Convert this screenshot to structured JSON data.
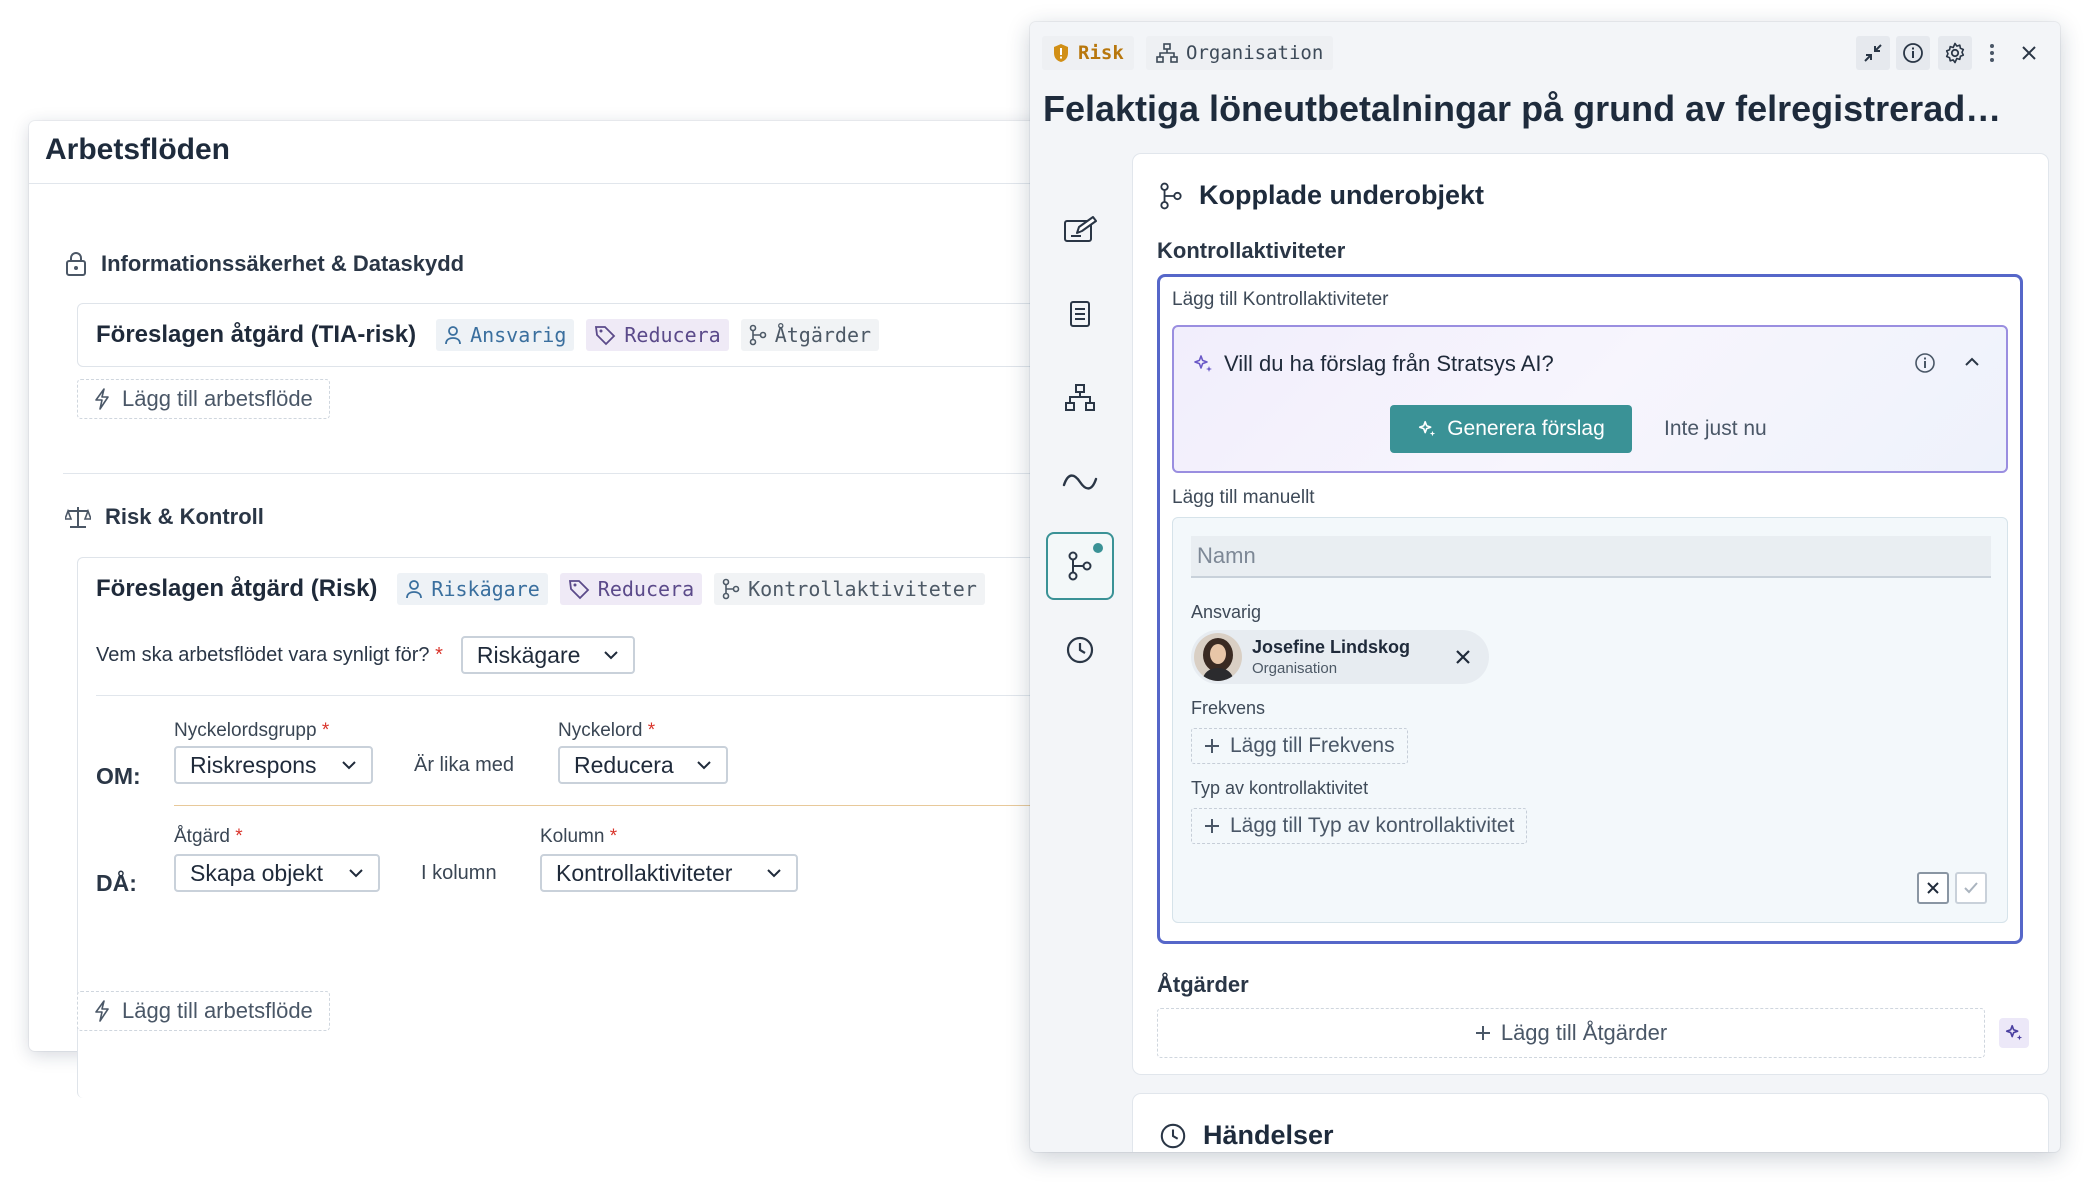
{
  "workflows_panel": {
    "title": "Arbetsflöden",
    "sections": [
      {
        "icon": "lock-icon",
        "label": "Informationssäkerhet & Dataskydd",
        "workflow": {
          "title": "Föreslagen åtgärd (TIA-risk)",
          "chips": [
            "Ansvarig",
            "Reducera",
            "Åtgärder"
          ]
        },
        "add_label": "Lägg till arbetsflöde"
      },
      {
        "icon": "scale-icon",
        "label": "Risk & Kontroll",
        "workflow": {
          "title": "Föreslagen åtgärd (Risk)",
          "chips": [
            "Riskägare",
            "Reducera",
            "Kontrollaktiviteter"
          ],
          "visibility_question": "Vem ska arbetsflödet vara synligt för?",
          "visibility_value": "Riskägare",
          "if": {
            "keyword": "OM:",
            "group_label": "Nyckelordsgrupp",
            "group_value": "Riskrespons",
            "operator": "Är lika med",
            "keyword_label": "Nyckelord",
            "keyword_value": "Reducera"
          },
          "then": {
            "keyword": "DÅ:",
            "action_label": "Åtgärd",
            "action_value": "Skapa objekt",
            "in_column": "I kolumn",
            "column_label": "Kolumn",
            "column_value": "Kontrollaktiviteter"
          }
        },
        "add_label": "Lägg till arbetsflöde"
      }
    ],
    "required_mark": "*"
  },
  "detail_panel": {
    "tags": {
      "risk": "Risk",
      "org": "Organisation"
    },
    "title": "Felaktiga löneutbetalningar på grund av felregistrerad…",
    "rail_icons": [
      "edit-icon",
      "document-icon",
      "hierarchy-icon",
      "wave-icon",
      "branch-icon",
      "clock-icon"
    ],
    "linked": {
      "heading": "Kopplade underobjekt",
      "controls_heading": "Kontrollaktiviteter",
      "add_controls_label": "Lägg till Kontrollaktiviteter",
      "ai_prompt": "Vill du ha förslag från Stratsys AI?",
      "generate_label": "Generera förslag",
      "not_now_label": "Inte just nu",
      "manual_label": "Lägg till manuellt",
      "name_placeholder": "Namn",
      "responsible_label": "Ansvarig",
      "person_name": "Josefine Lindskog",
      "person_org": "Organisation",
      "frequency_label": "Frekvens",
      "add_frequency": "Lägg till Frekvens",
      "type_label": "Typ av kontrollaktivitet",
      "add_type": "Lägg till Typ av kontrollaktivitet",
      "actions_heading": "Åtgärder",
      "add_actions": "Lägg till Åtgärder"
    },
    "events_heading": "Händelser"
  },
  "colors": {
    "accent_teal": "#3a9296",
    "focus_blue": "#5667c9",
    "ai_purple": "#9a8ee0",
    "risk_amber": "#b8770d",
    "required_red": "#d9342b"
  }
}
